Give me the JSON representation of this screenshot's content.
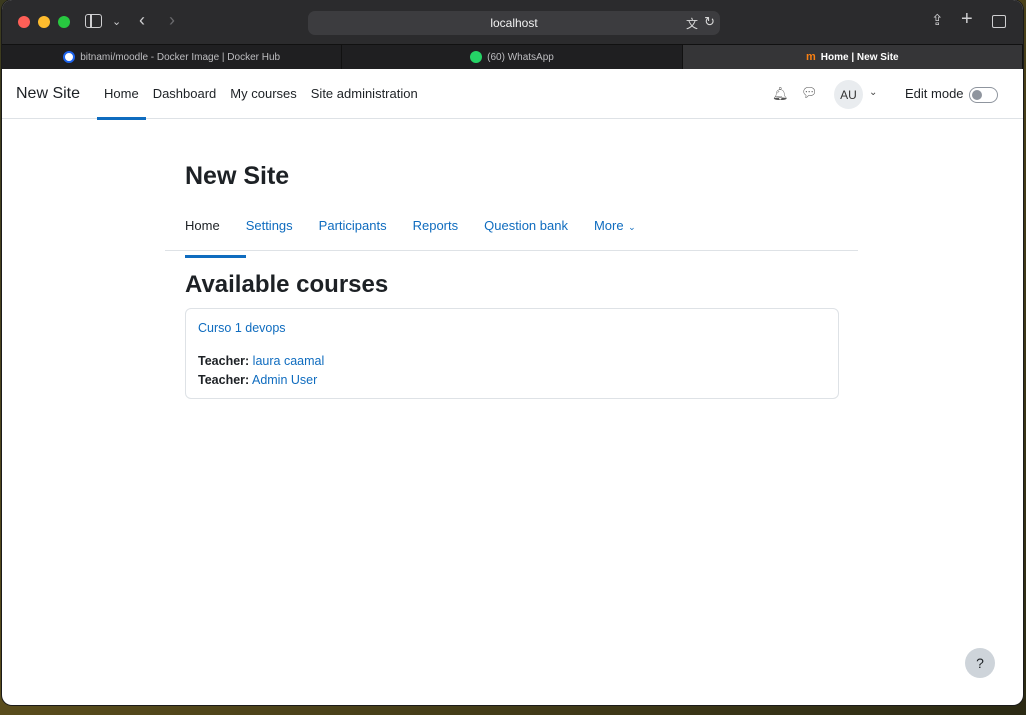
{
  "browser": {
    "url": "localhost",
    "tabs": [
      {
        "label": "bitnami/moodle - Docker Image | Docker Hub",
        "active": false
      },
      {
        "label": "(60) WhatsApp",
        "active": false
      },
      {
        "label": "Home | New Site",
        "active": true
      }
    ]
  },
  "navbar": {
    "brand": "New Site",
    "items": [
      "Home",
      "Dashboard",
      "My courses",
      "Site administration"
    ],
    "avatar_initials": "AU",
    "edit_mode_label": "Edit mode"
  },
  "page": {
    "title": "New Site",
    "secondary_tabs": [
      "Home",
      "Settings",
      "Participants",
      "Reports",
      "Question bank",
      "More"
    ],
    "section_title": "Available courses",
    "course": {
      "name": "Curso 1 devops",
      "teachers": [
        {
          "role": "Teacher:",
          "name": "laura caamal"
        },
        {
          "role": "Teacher:",
          "name": "Admin User"
        }
      ]
    },
    "help_label": "?"
  },
  "colors": {
    "link": "#0f6cbf",
    "text": "#1d2125"
  }
}
